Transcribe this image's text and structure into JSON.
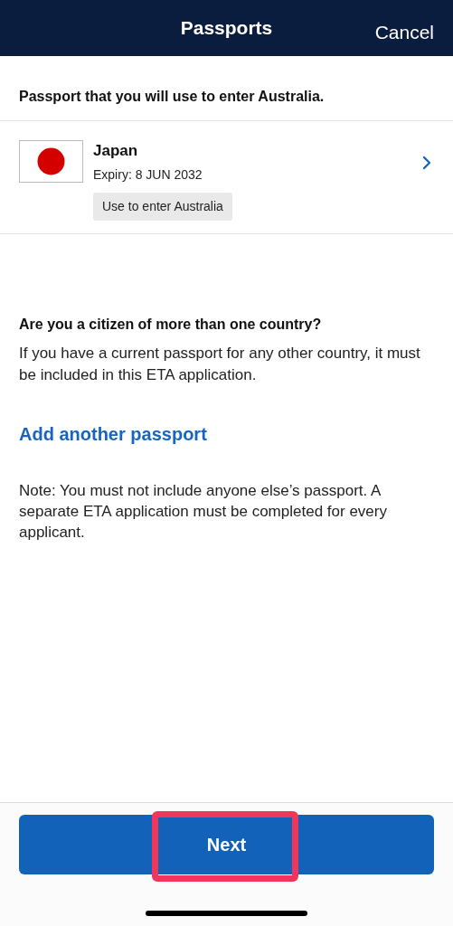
{
  "header": {
    "title": "Passports",
    "cancel": "Cancel"
  },
  "intro": "Passport that you will use to enter Australia.",
  "passport": {
    "country": "Japan",
    "expiry": "Expiry: 8 JUN 2032",
    "badge": "Use to enter Australia"
  },
  "question": {
    "heading": "Are you a citizen of more than one country?",
    "text": "If you have a current passport for any other country, it must be included in this ETA application."
  },
  "add_link": "Add another passport",
  "note": "Note: You must not include anyone else’s passport. A separate ETA application must be completed for every applicant.",
  "next_button": {
    "label": "Next",
    "highlighted": true
  }
}
